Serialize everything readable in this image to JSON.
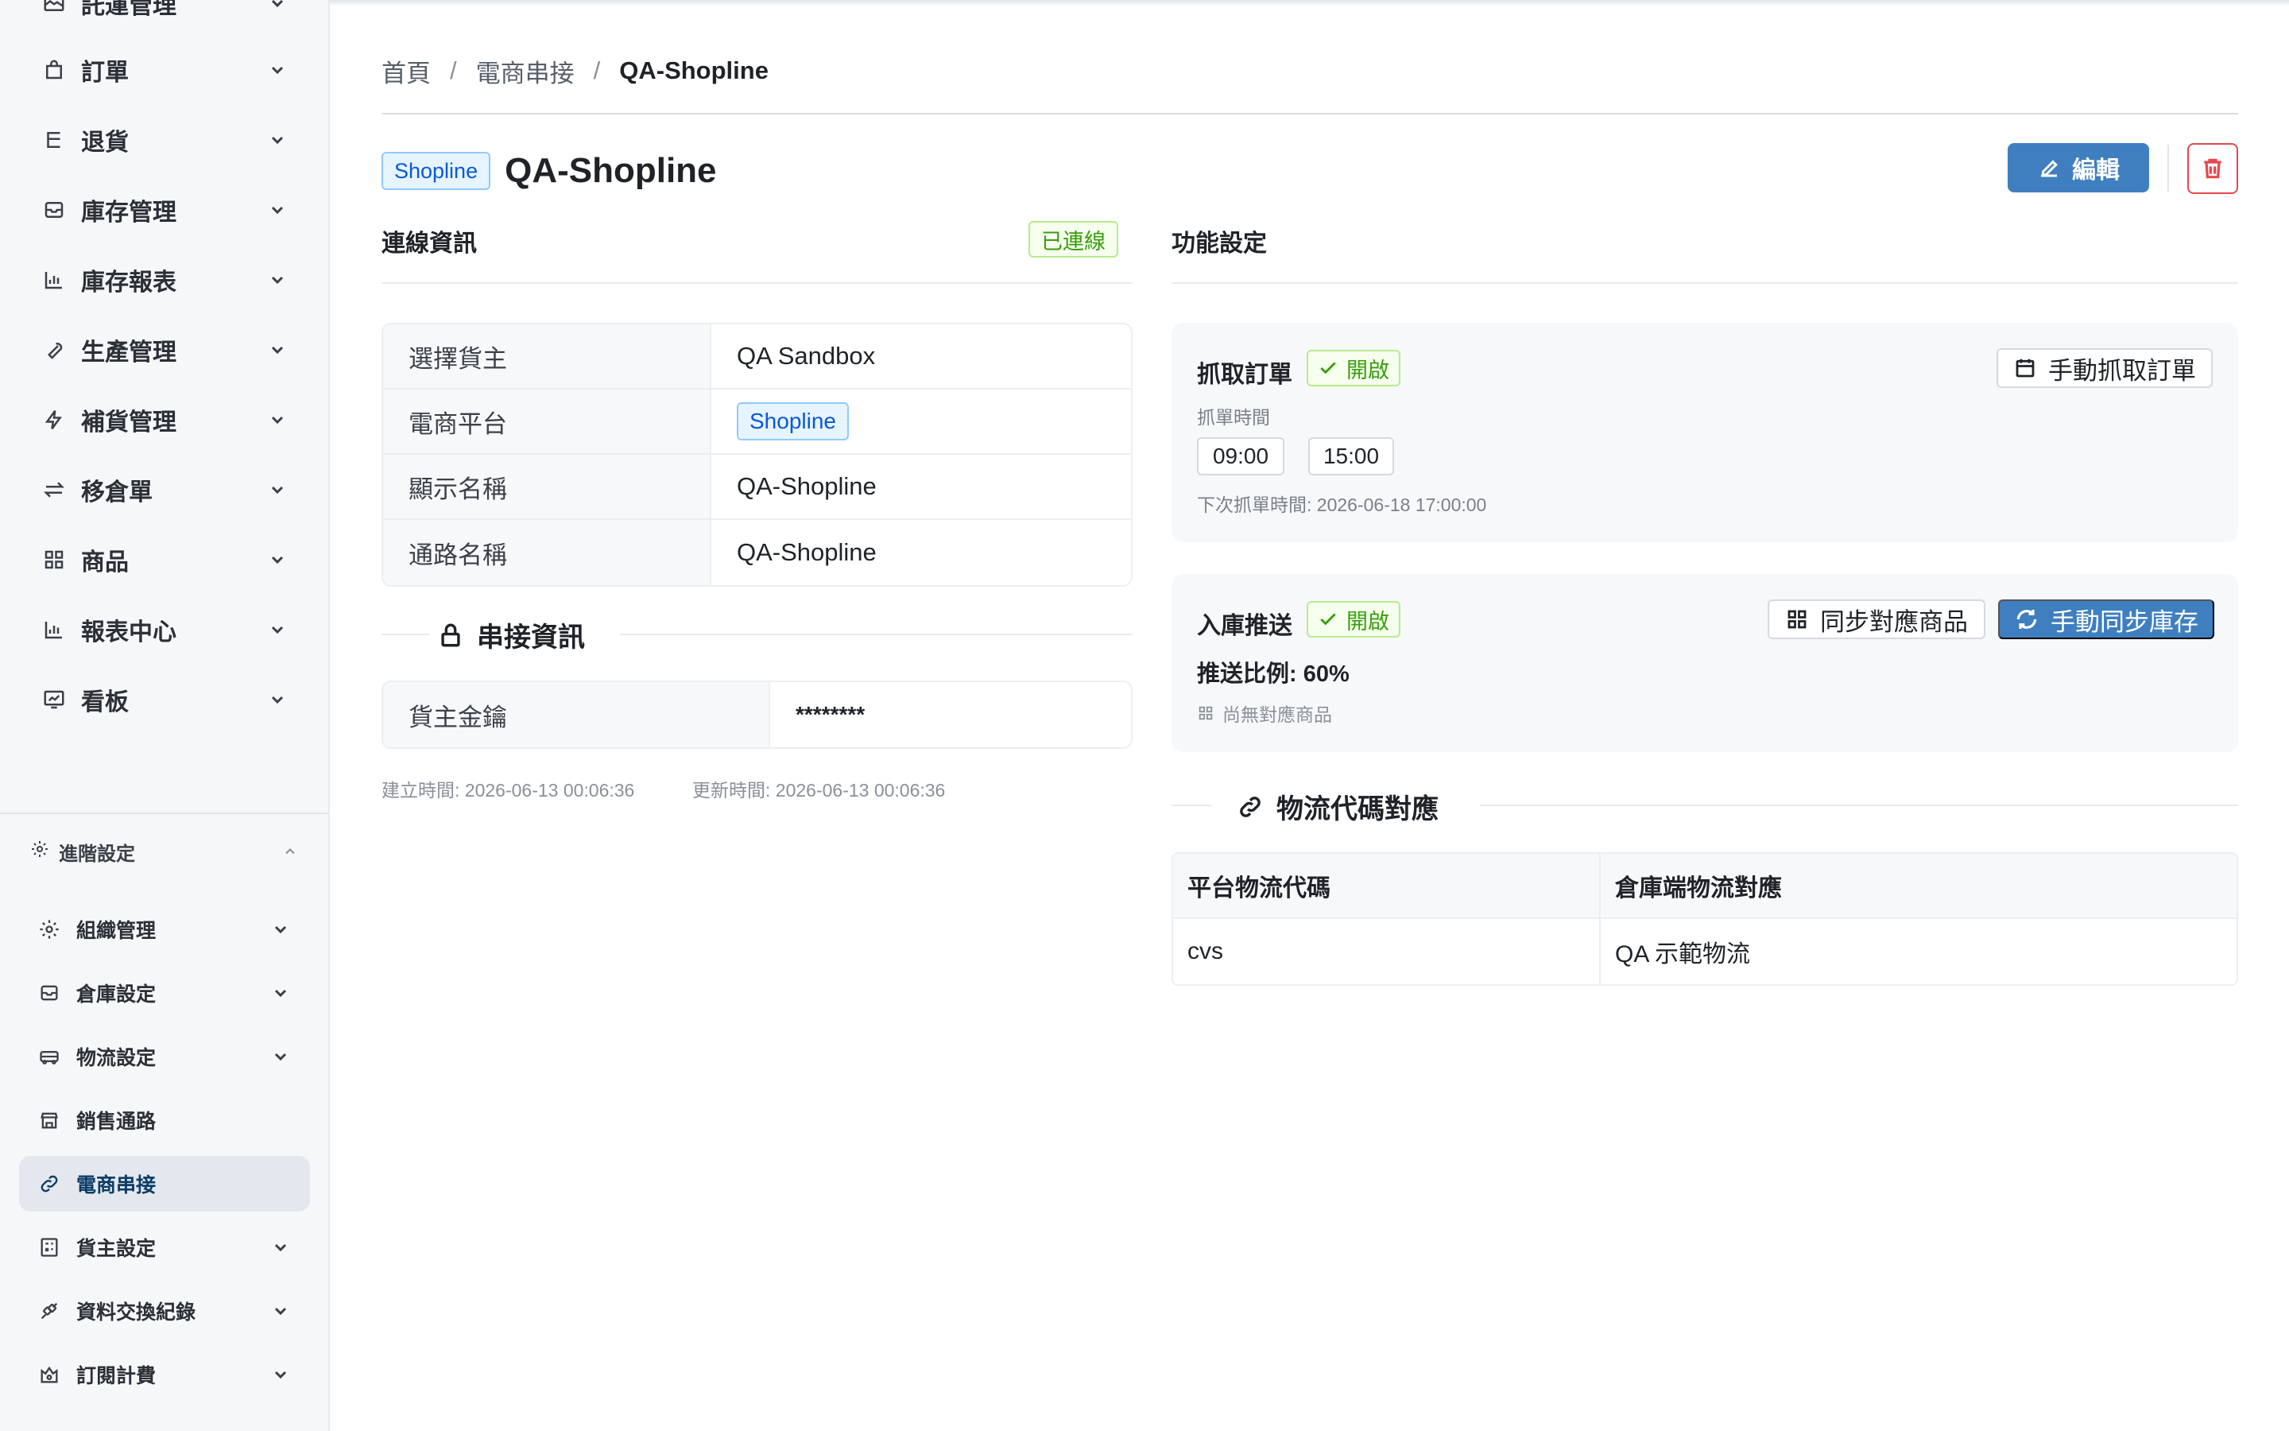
{
  "sidebar": {
    "items": [
      {
        "label": "託運管理",
        "icon": "shipping-label-icon"
      },
      {
        "label": "訂單",
        "icon": "shopping-bag-icon"
      },
      {
        "label": "退貨",
        "icon": "return-icon"
      },
      {
        "label": "庫存管理",
        "icon": "inbox-icon"
      },
      {
        "label": "庫存報表",
        "icon": "bar-chart-icon"
      },
      {
        "label": "生產管理",
        "icon": "wrench-icon"
      },
      {
        "label": "補貨管理",
        "icon": "lightning-icon"
      },
      {
        "label": "移倉單",
        "icon": "swap-icon"
      },
      {
        "label": "商品",
        "icon": "grid-icon"
      },
      {
        "label": "報表中心",
        "icon": "bar-chart-icon"
      },
      {
        "label": "看板",
        "icon": "dashboard-icon"
      }
    ],
    "advanced": {
      "label": "進階設定",
      "items": [
        {
          "label": "組織管理",
          "icon": "gear-icon"
        },
        {
          "label": "倉庫設定",
          "icon": "inbox-icon"
        },
        {
          "label": "物流設定",
          "icon": "truck-icon"
        },
        {
          "label": "銷售通路",
          "icon": "store-icon"
        },
        {
          "label": "電商串接",
          "icon": "link-icon"
        },
        {
          "label": "貨主設定",
          "icon": "calculator-icon"
        },
        {
          "label": "資料交換紀錄",
          "icon": "api-icon"
        },
        {
          "label": "訂閱計費",
          "icon": "subscription-icon"
        }
      ]
    }
  },
  "breadcrumb": {
    "home": "首頁",
    "parent": "電商串接",
    "current": "QA-Shopline",
    "separator": "/"
  },
  "header": {
    "platform_tag": "Shopline",
    "title": "QA-Shopline",
    "edit_label": "編輯"
  },
  "connection": {
    "title": "連線資訊",
    "status": "已連線",
    "rows": [
      {
        "label": "選擇貨主",
        "value": "QA Sandbox"
      },
      {
        "label": "電商平台",
        "value": "Shopline"
      },
      {
        "label": "顯示名稱",
        "value": "QA-Shopline"
      },
      {
        "label": "通路名稱",
        "value": "QA-Shopline"
      }
    ]
  },
  "integration": {
    "title": "串接資訊",
    "rows": [
      {
        "label": "貨主金鑰",
        "value": "********"
      }
    ]
  },
  "meta": {
    "created": "建立時間: 2026-06-13 00:06:36",
    "updated": "更新時間: 2026-06-13 00:06:36"
  },
  "features": {
    "title": "功能設定",
    "order_fetch": {
      "title": "抓取訂單",
      "status": "開啟",
      "manual_button": "手動抓取訂單",
      "time_label": "抓單時間",
      "times": [
        "09:00",
        "15:00"
      ],
      "next_run": "下次抓單時間: 2026-06-18 17:00:00"
    },
    "inventory_push": {
      "title": "入庫推送",
      "status": "開啟",
      "sync_products_button": "同步對應商品",
      "manual_sync_button": "手動同步庫存",
      "ratio": "推送比例: 60%",
      "no_mapping": "尚無對應商品"
    }
  },
  "logistics_mapping": {
    "title": "物流代碼對應",
    "columns": [
      "平台物流代碼",
      "倉庫端物流對應"
    ],
    "rows": [
      [
        "cvs",
        "QA 示範物流"
      ]
    ]
  },
  "colors": {
    "primary": "#3f7fc0",
    "success": "#389e0d",
    "danger": "#e5484d",
    "tag_blue": "#0958d9"
  }
}
